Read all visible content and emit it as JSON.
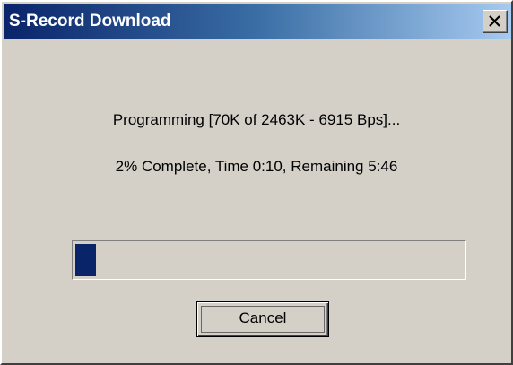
{
  "window": {
    "title": "S-Record Download"
  },
  "status": {
    "line1": "Programming [70K of 2463K - 6915 Bps]...",
    "line2": "2% Complete, Time 0:10, Remaining 5:46"
  },
  "progress": {
    "percent": 2,
    "fill_color": "#0a246a"
  },
  "buttons": {
    "cancel_label": "Cancel",
    "close_icon": "close-icon"
  },
  "colors": {
    "dialog_background": "#d4d0c8",
    "titlebar_start": "#0a246a",
    "titlebar_end": "#a6caf0",
    "title_text": "#ffffff"
  }
}
